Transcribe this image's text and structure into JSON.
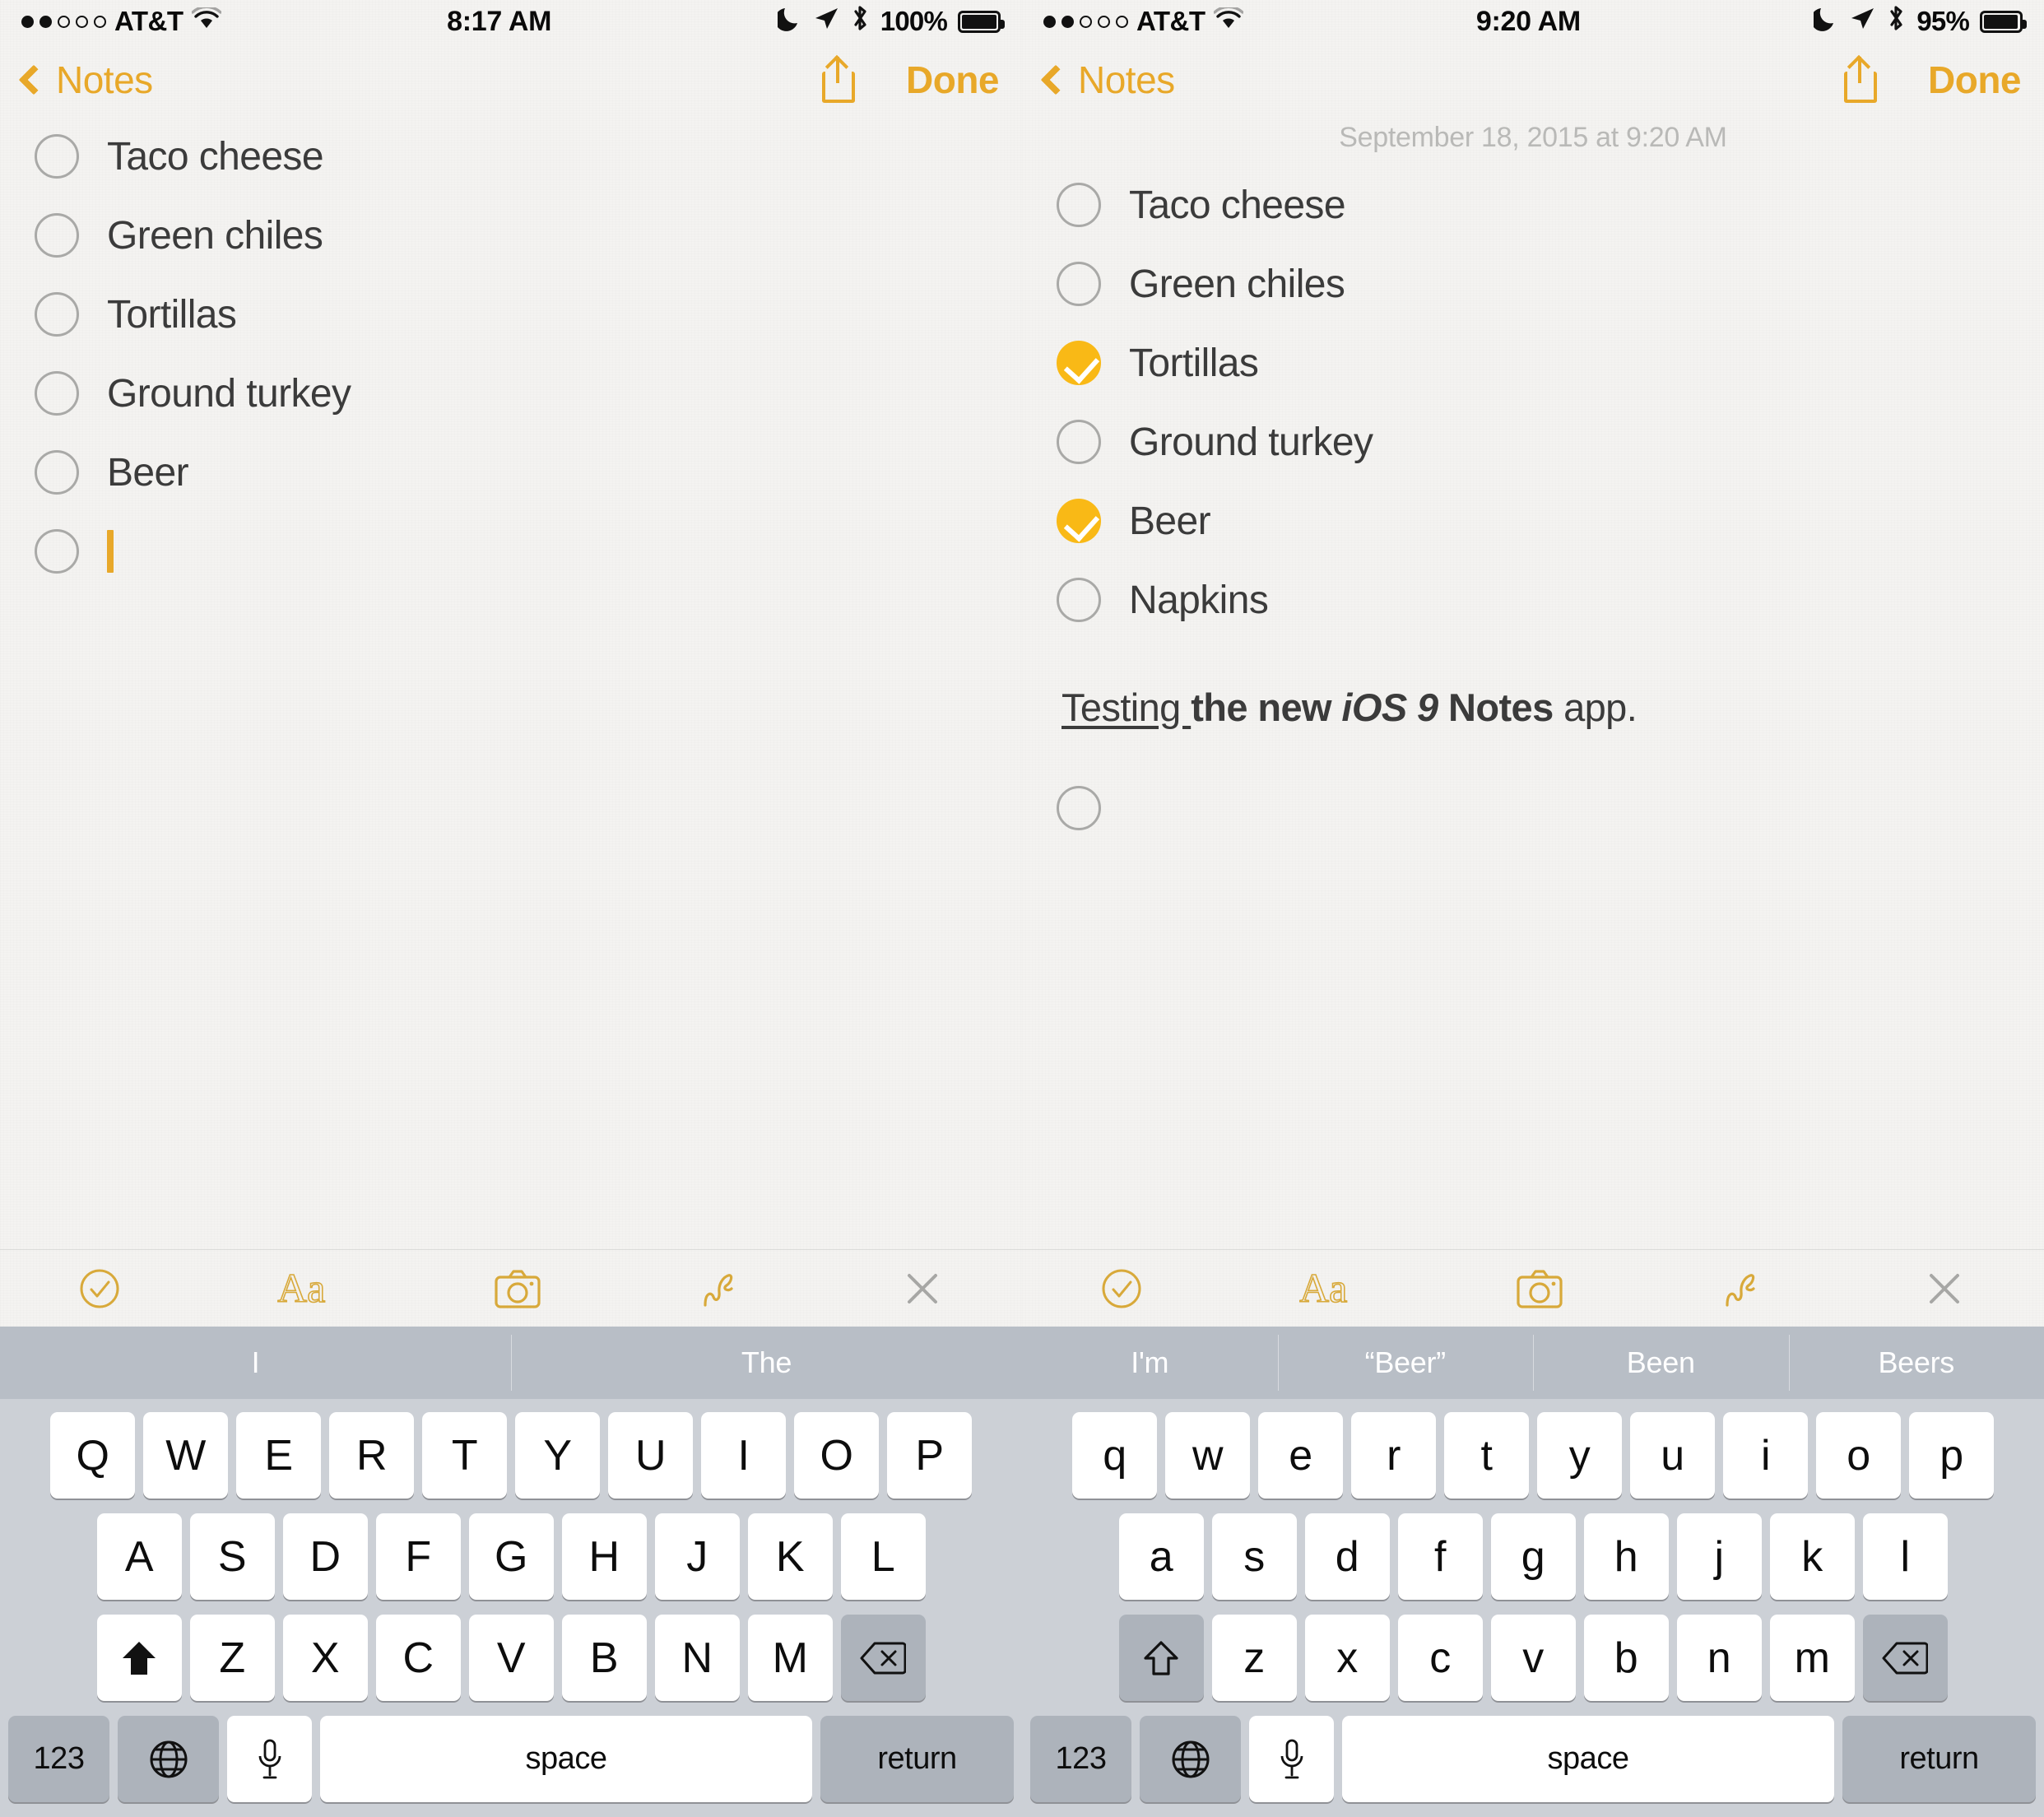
{
  "panels": [
    {
      "status": {
        "signal_dots": [
          true,
          true,
          false,
          false,
          false
        ],
        "carrier": "AT&T",
        "wifi": "wifi-icon",
        "time": "8:17 AM",
        "dnd": "moon-icon",
        "location": "location-arrow-icon",
        "bluetooth": "bluetooth-icon",
        "battery_pct": "100%"
      },
      "nav": {
        "back_label": "Notes",
        "share_label": "share-icon",
        "done_label": "Done"
      },
      "note": {
        "date": "",
        "items": [
          {
            "label": "Taco cheese",
            "checked": false
          },
          {
            "label": "Green chiles",
            "checked": false
          },
          {
            "label": "Tortillas",
            "checked": false
          },
          {
            "label": "Ground turkey",
            "checked": false
          },
          {
            "label": "Beer",
            "checked": false
          },
          {
            "label": "",
            "checked": false,
            "cursor": true
          }
        ],
        "rich_text": null
      },
      "toolbar": [
        {
          "name": "checklist-icon",
          "label": "checklist"
        },
        {
          "name": "text-format-icon",
          "label": "Aa"
        },
        {
          "name": "camera-icon",
          "label": "camera"
        },
        {
          "name": "sketch-icon",
          "label": "sketch"
        },
        {
          "name": "close-icon",
          "label": "close"
        }
      ],
      "keyboard": {
        "suggestions": [
          "I",
          "The"
        ],
        "rows": [
          [
            "Q",
            "W",
            "E",
            "R",
            "T",
            "Y",
            "U",
            "I",
            "O",
            "P"
          ],
          [
            "A",
            "S",
            "D",
            "F",
            "G",
            "H",
            "J",
            "K",
            "L"
          ],
          [
            "Z",
            "X",
            "C",
            "V",
            "B",
            "N",
            "M"
          ]
        ],
        "shift_label": "shift-icon",
        "shift_active": true,
        "backspace_label": "backspace-icon",
        "num_label": "123",
        "globe_label": "globe-icon",
        "mic_label": "microphone-icon",
        "space_label": "space",
        "return_label": "return"
      }
    },
    {
      "status": {
        "signal_dots": [
          true,
          true,
          false,
          false,
          false
        ],
        "carrier": "AT&T",
        "wifi": "wifi-icon",
        "time": "9:20 AM",
        "dnd": "moon-icon",
        "location": "location-arrow-icon",
        "bluetooth": "bluetooth-icon",
        "battery_pct": "95%"
      },
      "nav": {
        "back_label": "Notes",
        "share_label": "share-icon",
        "done_label": "Done"
      },
      "note": {
        "date": "September 18, 2015 at 9:20 AM",
        "items": [
          {
            "label": "Taco cheese",
            "checked": false
          },
          {
            "label": "Green chiles",
            "checked": false
          },
          {
            "label": "Tortillas",
            "checked": true
          },
          {
            "label": "Ground turkey",
            "checked": false
          },
          {
            "label": "Beer",
            "checked": true
          },
          {
            "label": "Napkins",
            "checked": false
          }
        ],
        "rich_text": {
          "underline": "Testing ",
          "bold": "the new ",
          "bold_italic": "iOS 9 ",
          "bold2": "Notes",
          "plain": " app."
        },
        "trailing_empty_checkbox": true
      },
      "toolbar": [
        {
          "name": "checklist-icon",
          "label": "checklist"
        },
        {
          "name": "text-format-icon",
          "label": "Aa"
        },
        {
          "name": "camera-icon",
          "label": "camera"
        },
        {
          "name": "sketch-icon",
          "label": "sketch"
        },
        {
          "name": "close-icon",
          "label": "close"
        }
      ],
      "keyboard": {
        "suggestions": [
          "I'm",
          "“Beer”",
          "Been",
          "Beers"
        ],
        "rows": [
          [
            "q",
            "w",
            "e",
            "r",
            "t",
            "y",
            "u",
            "i",
            "o",
            "p"
          ],
          [
            "a",
            "s",
            "d",
            "f",
            "g",
            "h",
            "j",
            "k",
            "l"
          ],
          [
            "z",
            "x",
            "c",
            "v",
            "b",
            "n",
            "m"
          ]
        ],
        "shift_label": "shift-icon",
        "shift_active": false,
        "backspace_label": "backspace-icon",
        "num_label": "123",
        "globe_label": "globe-icon",
        "mic_label": "microphone-icon",
        "space_label": "space",
        "return_label": "return"
      }
    }
  ],
  "colors": {
    "accent": "#e8a829",
    "check_fill": "#f9b916",
    "paper": "#f4f3f1",
    "keyboard_bg": "#ccd0d6",
    "sugg_bg": "#b8bec6",
    "key_fn": "#adb3bb"
  }
}
